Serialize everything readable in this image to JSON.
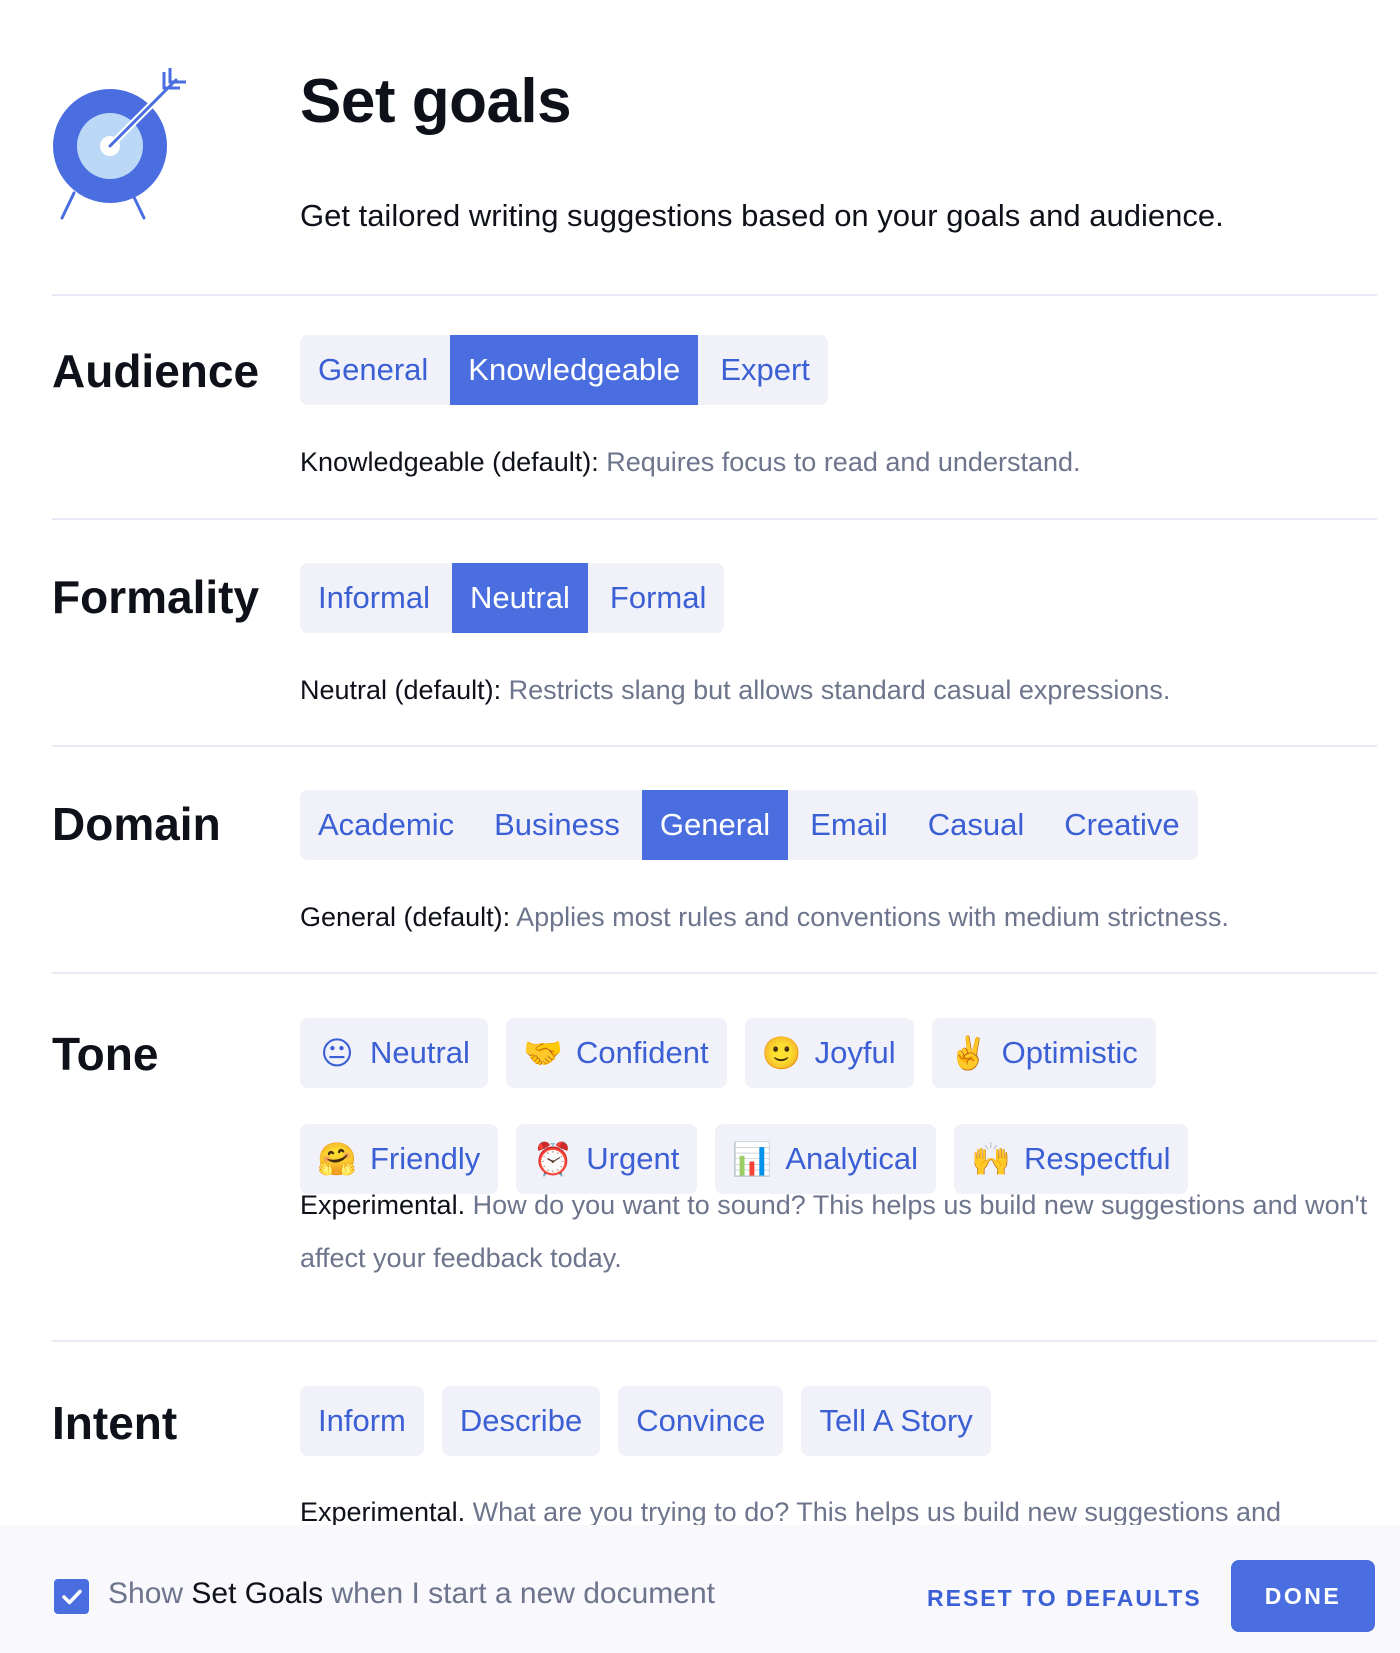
{
  "header": {
    "title": "Set goals",
    "subtitle": "Get tailored writing suggestions based on your goals and audience.",
    "logo_icon": "target-arrow-icon"
  },
  "colors": {
    "accent": "#4a6ee0",
    "accent_text": "#3b5fd4",
    "chip_bg": "#f0f1f9",
    "divider": "#e7e9f5",
    "footer_bg": "#f8f8fd",
    "muted_text": "#6d758d"
  },
  "audience": {
    "label": "Audience",
    "options": [
      "General",
      "Knowledgeable",
      "Expert"
    ],
    "selected": "Knowledgeable",
    "desc_strong": "Knowledgeable (default):",
    "desc_muted": " Requires focus to read and understand."
  },
  "formality": {
    "label": "Formality",
    "options": [
      "Informal",
      "Neutral",
      "Formal"
    ],
    "selected": "Neutral",
    "desc_strong": "Neutral (default):",
    "desc_muted": " Restricts slang but allows standard casual expressions."
  },
  "domain": {
    "label": "Domain",
    "options": [
      "Academic",
      "Business",
      "General",
      "Email",
      "Casual",
      "Creative"
    ],
    "selected": "General",
    "desc_strong": "General (default):",
    "desc_muted": " Applies most rules and conventions with medium strictness."
  },
  "tone": {
    "label": "Tone",
    "options": [
      {
        "emoji": "😐",
        "icon": "neutral-face-icon",
        "label": "Neutral"
      },
      {
        "emoji": "🤝",
        "icon": "handshake-icon",
        "label": "Confident"
      },
      {
        "emoji": "🙂",
        "icon": "smiling-face-icon",
        "label": "Joyful"
      },
      {
        "emoji": "✌️",
        "icon": "victory-hand-icon",
        "label": "Optimistic"
      },
      {
        "emoji": "🤗",
        "icon": "hugging-face-icon",
        "label": "Friendly"
      },
      {
        "emoji": "⏰",
        "icon": "alarm-clock-icon",
        "label": "Urgent"
      },
      {
        "emoji": "📊",
        "icon": "bar-chart-icon",
        "label": "Analytical"
      },
      {
        "emoji": "🙌",
        "icon": "raised-hands-icon",
        "label": "Respectful"
      }
    ],
    "desc_strong": "Experimental.",
    "desc_muted": " How do you want to sound? This helps us build new suggestions and won't affect your feedback today."
  },
  "intent": {
    "label": "Intent",
    "options": [
      "Inform",
      "Describe",
      "Convince",
      "Tell A Story"
    ],
    "desc_strong": "Experimental.",
    "desc_muted": " What are you trying to do? This helps us build new suggestions and"
  },
  "footer": {
    "checkbox_checked": true,
    "text_pre": "Show ",
    "text_strong": "Set Goals",
    "text_post": " when I start a new document",
    "reset_label": "RESET TO DEFAULTS",
    "done_label": "DONE"
  }
}
